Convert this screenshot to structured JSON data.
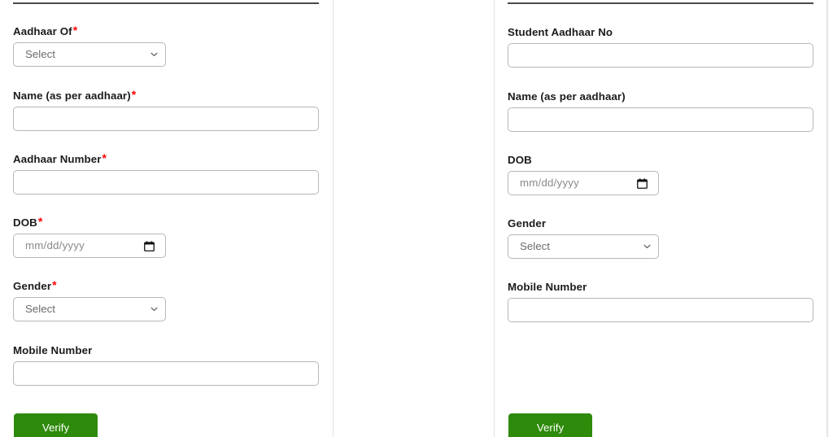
{
  "colors": {
    "accent_green": "#2d8a0a",
    "required_red": "#ff0000",
    "border_grey": "#b7b7b7",
    "rule_dark": "#4a4a4a",
    "panel_divider": "#e3e3e3"
  },
  "left_form": {
    "name": "aadhaar-verification-form",
    "fields": [
      {
        "key": "aadhaar_of",
        "label": "Aadhaar Of",
        "required": true,
        "type": "select",
        "value": "Select",
        "options": [
          "Select"
        ]
      },
      {
        "key": "name_as_per_aadhaar",
        "label": "Name (as per aadhaar)",
        "required": true,
        "type": "text",
        "value": "",
        "placeholder": ""
      },
      {
        "key": "aadhaar_number",
        "label": "Aadhaar Number",
        "required": true,
        "type": "text",
        "value": "",
        "placeholder": ""
      },
      {
        "key": "dob",
        "label": "DOB",
        "required": true,
        "type": "date",
        "value": "",
        "placeholder": "mm/dd/yyyy"
      },
      {
        "key": "gender",
        "label": "Gender",
        "required": true,
        "type": "select",
        "value": "Select",
        "options": [
          "Select"
        ]
      },
      {
        "key": "mobile_number",
        "label": "Mobile Number",
        "required": false,
        "type": "text",
        "value": "",
        "placeholder": ""
      }
    ],
    "verify_label": "Verify"
  },
  "right_form": {
    "name": "student-aadhaar-details-form",
    "fields": [
      {
        "key": "student_aadhaar_no",
        "label": "Student Aadhaar No",
        "required": false,
        "type": "text",
        "value": "",
        "placeholder": ""
      },
      {
        "key": "name_as_per_aadhaar",
        "label": "Name (as per aadhaar)",
        "required": false,
        "type": "text",
        "value": "",
        "placeholder": ""
      },
      {
        "key": "dob",
        "label": "DOB",
        "required": false,
        "type": "date",
        "value": "",
        "placeholder": "mm/dd/yyyy"
      },
      {
        "key": "gender",
        "label": "Gender",
        "required": false,
        "type": "select",
        "value": "Select",
        "options": [
          "Select"
        ]
      },
      {
        "key": "mobile_number",
        "label": "Mobile Number",
        "required": false,
        "type": "text",
        "value": "",
        "placeholder": ""
      }
    ],
    "verify_label": "Verify"
  },
  "icons": {
    "chevron_down": "chevron-down-icon",
    "calendar": "calendar-icon"
  }
}
